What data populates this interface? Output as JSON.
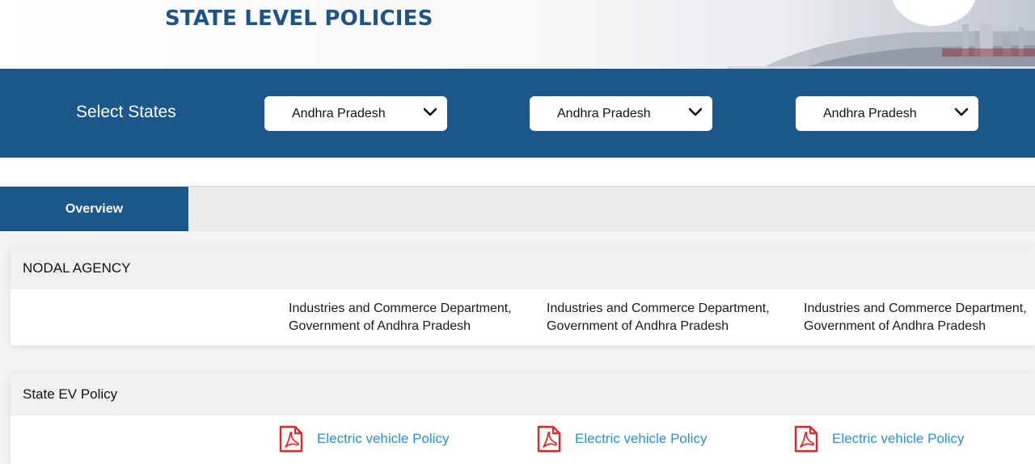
{
  "banner": {
    "title": "STATE LEVEL POLICIES"
  },
  "select_bar": {
    "label": "Select States",
    "selects": [
      {
        "value": "Andhra Pradesh"
      },
      {
        "value": "Andhra Pradesh"
      },
      {
        "value": "Andhra Pradesh"
      }
    ]
  },
  "tabs": [
    {
      "label": "Overview",
      "active": true
    }
  ],
  "nodal_agency": {
    "heading": "NODAL AGENCY",
    "columns": [
      {
        "line1": "Industries and Commerce Department,",
        "line2": "Government of Andhra Pradesh"
      },
      {
        "line1": "Industries and Commerce Department,",
        "line2": "Government of Andhra Pradesh"
      },
      {
        "line1": "Industries and Commerce Department,",
        "line2": "Government of Andhra Pradesh"
      }
    ]
  },
  "ev_policy": {
    "heading": "State EV Policy",
    "links": [
      {
        "label": "Electric vehicle Policy",
        "icon": "pdf-icon"
      },
      {
        "label": "Electric vehicle Policy",
        "icon": "pdf-icon"
      },
      {
        "label": "Electric vehicle Policy",
        "icon": "pdf-icon"
      }
    ]
  },
  "colors": {
    "brand_blue": "#1b578a",
    "title_blue": "#1c5487",
    "link_blue": "#2a8fd6",
    "pdf_red": "#e0262b"
  }
}
